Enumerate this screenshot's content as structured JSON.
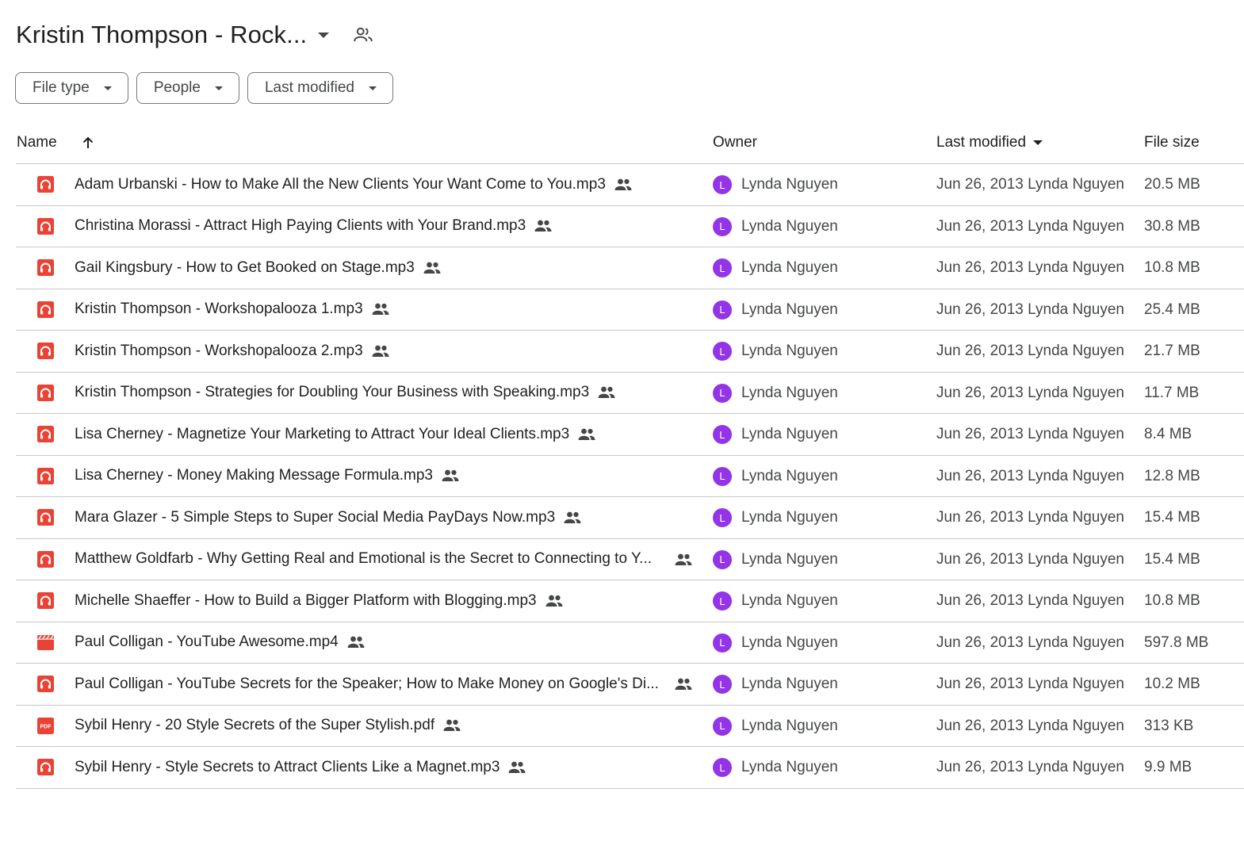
{
  "folder": {
    "title": "Kristin Thompson - Rock...",
    "shared_icon": "people-outline-icon"
  },
  "filters": [
    {
      "label": "File type"
    },
    {
      "label": "People"
    },
    {
      "label": "Last modified"
    }
  ],
  "columns": {
    "name": "Name",
    "owner": "Owner",
    "last_modified": "Last modified",
    "file_size": "File size",
    "name_sort_icon": "arrow-up-icon"
  },
  "colors": {
    "file_red": "#ea4335",
    "avatar_purple": "#9334e6"
  },
  "files": [
    {
      "name": "Adam Urbanski - How to Make All the New Clients Your Want Come to You.mp3",
      "type": "audio",
      "owner": "Lynda Nguyen",
      "avatar": "L",
      "modified": "Jun 26, 2013 Lynda Nguyen",
      "size": "20.5 MB"
    },
    {
      "name": "Christina Morassi - Attract High Paying Clients with Your Brand.mp3",
      "type": "audio",
      "owner": "Lynda Nguyen",
      "avatar": "L",
      "modified": "Jun 26, 2013 Lynda Nguyen",
      "size": "30.8 MB"
    },
    {
      "name": "Gail Kingsbury - How to Get Booked on Stage.mp3",
      "type": "audio",
      "owner": "Lynda Nguyen",
      "avatar": "L",
      "modified": "Jun 26, 2013 Lynda Nguyen",
      "size": "10.8 MB"
    },
    {
      "name": "Kristin Thompson - Workshopalooza 1.mp3",
      "type": "audio",
      "owner": "Lynda Nguyen",
      "avatar": "L",
      "modified": "Jun 26, 2013 Lynda Nguyen",
      "size": "25.4 MB"
    },
    {
      "name": "Kristin Thompson - Workshopalooza 2.mp3",
      "type": "audio",
      "owner": "Lynda Nguyen",
      "avatar": "L",
      "modified": "Jun 26, 2013 Lynda Nguyen",
      "size": "21.7 MB"
    },
    {
      "name": "Kristin Thompson - Strategies for Doubling Your Business with Speaking.mp3",
      "type": "audio",
      "owner": "Lynda Nguyen",
      "avatar": "L",
      "modified": "Jun 26, 2013 Lynda Nguyen",
      "size": "11.7 MB"
    },
    {
      "name": "Lisa Cherney - Magnetize Your Marketing to Attract Your Ideal Clients.mp3",
      "type": "audio",
      "owner": "Lynda Nguyen",
      "avatar": "L",
      "modified": "Jun 26, 2013 Lynda Nguyen",
      "size": "8.4 MB"
    },
    {
      "name": "Lisa Cherney - Money Making Message Formula.mp3",
      "type": "audio",
      "owner": "Lynda Nguyen",
      "avatar": "L",
      "modified": "Jun 26, 2013 Lynda Nguyen",
      "size": "12.8 MB"
    },
    {
      "name": "Mara Glazer - 5 Simple Steps to Super Social Media PayDays Now.mp3",
      "type": "audio",
      "owner": "Lynda Nguyen",
      "avatar": "L",
      "modified": "Jun 26, 2013 Lynda Nguyen",
      "size": "15.4 MB"
    },
    {
      "name": "Matthew Goldfarb - Why Getting Real and Emotional is the Secret to Connecting to Y...",
      "type": "audio",
      "truncated": true,
      "owner": "Lynda Nguyen",
      "avatar": "L",
      "modified": "Jun 26, 2013 Lynda Nguyen",
      "size": "15.4 MB"
    },
    {
      "name": "Michelle Shaeffer - How to Build a Bigger Platform with Blogging.mp3",
      "type": "audio",
      "owner": "Lynda Nguyen",
      "avatar": "L",
      "modified": "Jun 26, 2013 Lynda Nguyen",
      "size": "10.8 MB"
    },
    {
      "name": "Paul Colligan - YouTube Awesome.mp4",
      "type": "video",
      "owner": "Lynda Nguyen",
      "avatar": "L",
      "modified": "Jun 26, 2013 Lynda Nguyen",
      "size": "597.8 MB"
    },
    {
      "name": "Paul Colligan - YouTube Secrets for the Speaker; How to Make Money on Google's Di...",
      "type": "audio",
      "truncated": true,
      "owner": "Lynda Nguyen",
      "avatar": "L",
      "modified": "Jun 26, 2013 Lynda Nguyen",
      "size": "10.2 MB"
    },
    {
      "name": "Sybil Henry - 20 Style Secrets of the Super Stylish.pdf",
      "type": "pdf",
      "owner": "Lynda Nguyen",
      "avatar": "L",
      "modified": "Jun 26, 2013 Lynda Nguyen",
      "size": "313 KB"
    },
    {
      "name": "Sybil Henry - Style Secrets to Attract Clients Like a Magnet.mp3",
      "type": "audio",
      "owner": "Lynda Nguyen",
      "avatar": "L",
      "modified": "Jun 26, 2013 Lynda Nguyen",
      "size": "9.9 MB"
    }
  ]
}
